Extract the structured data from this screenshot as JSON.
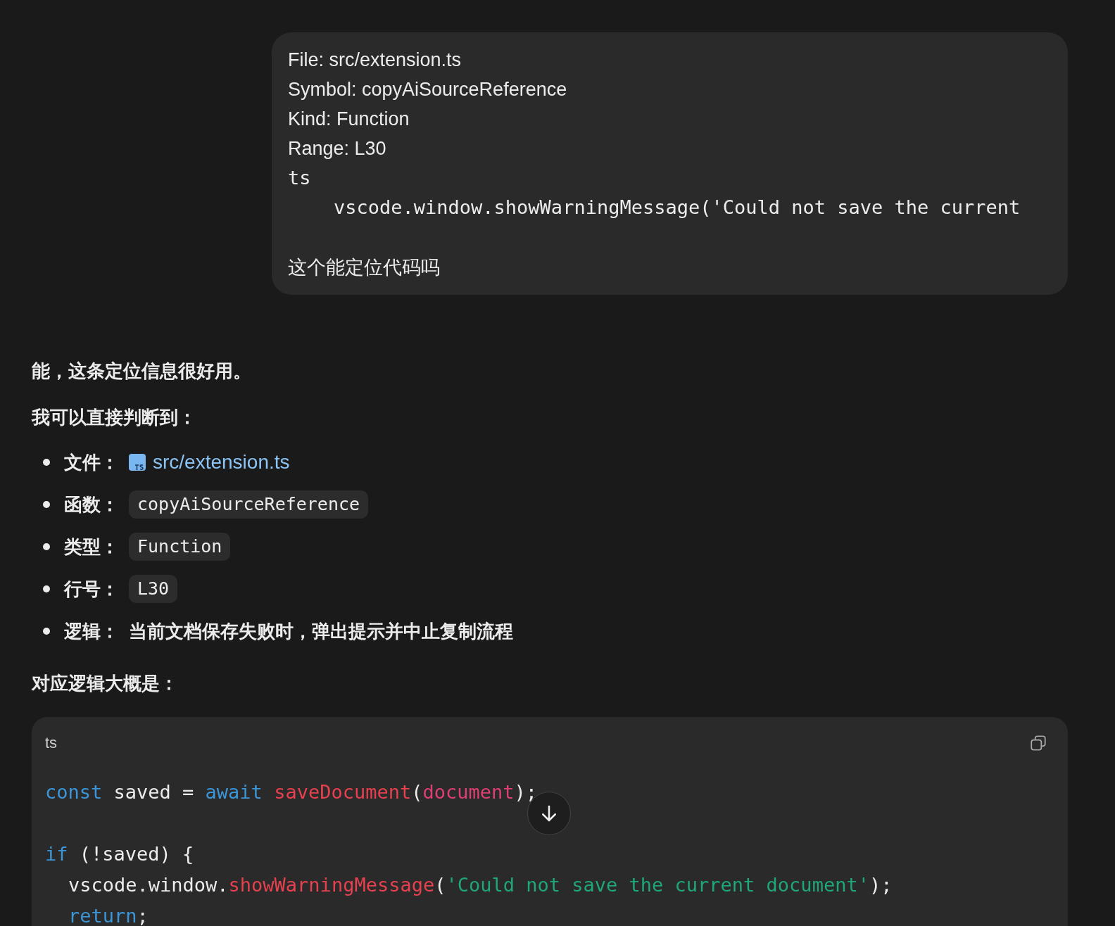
{
  "user_message": {
    "lines": [
      {
        "kind": "text",
        "text": "File: src/extension.ts"
      },
      {
        "kind": "text",
        "text": "Symbol: copyAiSourceReference"
      },
      {
        "kind": "text",
        "text": "Kind: Function"
      },
      {
        "kind": "text",
        "text": "Range: L30"
      },
      {
        "kind": "code",
        "text": "ts"
      },
      {
        "kind": "code",
        "text": "    vscode.window.showWarningMessage('Could not save the current"
      },
      {
        "kind": "text",
        "text": "这个能定位代码吗",
        "gap_before": true
      }
    ]
  },
  "answer": {
    "paragraphs": [
      "能，这条定位信息很好用。",
      "我可以直接判断到："
    ],
    "bullets": [
      {
        "label": "文件：",
        "kind": "file_link",
        "value": "src/extension.ts"
      },
      {
        "label": "函数：",
        "kind": "code",
        "value": "copyAiSourceReference"
      },
      {
        "label": "类型：",
        "kind": "code",
        "value": "Function"
      },
      {
        "label": "行号：",
        "kind": "code",
        "value": "L30"
      },
      {
        "label": "逻辑：",
        "kind": "text",
        "value": "当前文档保存失败时，弹出提示并中止复制流程"
      }
    ],
    "outro": "对应逻辑大概是：",
    "code_block": {
      "language": "ts",
      "lines": [
        {
          "gap_before": false,
          "indent": false,
          "tokens": [
            {
              "kind": "keyword",
              "s": "const"
            },
            {
              "kind": "plain",
              "s": " saved = "
            },
            {
              "kind": "keyword",
              "s": "await "
            },
            {
              "kind": "func",
              "s": "saveDocument"
            },
            {
              "kind": "plain",
              "s": "("
            },
            {
              "kind": "param",
              "s": "document"
            },
            {
              "kind": "plain",
              "s": ");"
            }
          ]
        },
        {
          "gap_before": true,
          "indent": false,
          "tokens": [
            {
              "kind": "keyword",
              "s": "if"
            },
            {
              "kind": "plain",
              "s": " (!saved) {"
            }
          ]
        },
        {
          "gap_before": false,
          "indent": true,
          "tokens": [
            {
              "kind": "plain",
              "s": "vscode.window."
            },
            {
              "kind": "func",
              "s": "showWarningMessage"
            },
            {
              "kind": "plain",
              "s": "("
            },
            {
              "kind": "string",
              "s": "'Could not save the current document'"
            },
            {
              "kind": "plain",
              "s": ");"
            }
          ]
        },
        {
          "gap_before": false,
          "indent": true,
          "tokens": [
            {
              "kind": "keyword",
              "s": "return"
            },
            {
              "kind": "plain",
              "s": ";"
            }
          ]
        }
      ]
    }
  }
}
